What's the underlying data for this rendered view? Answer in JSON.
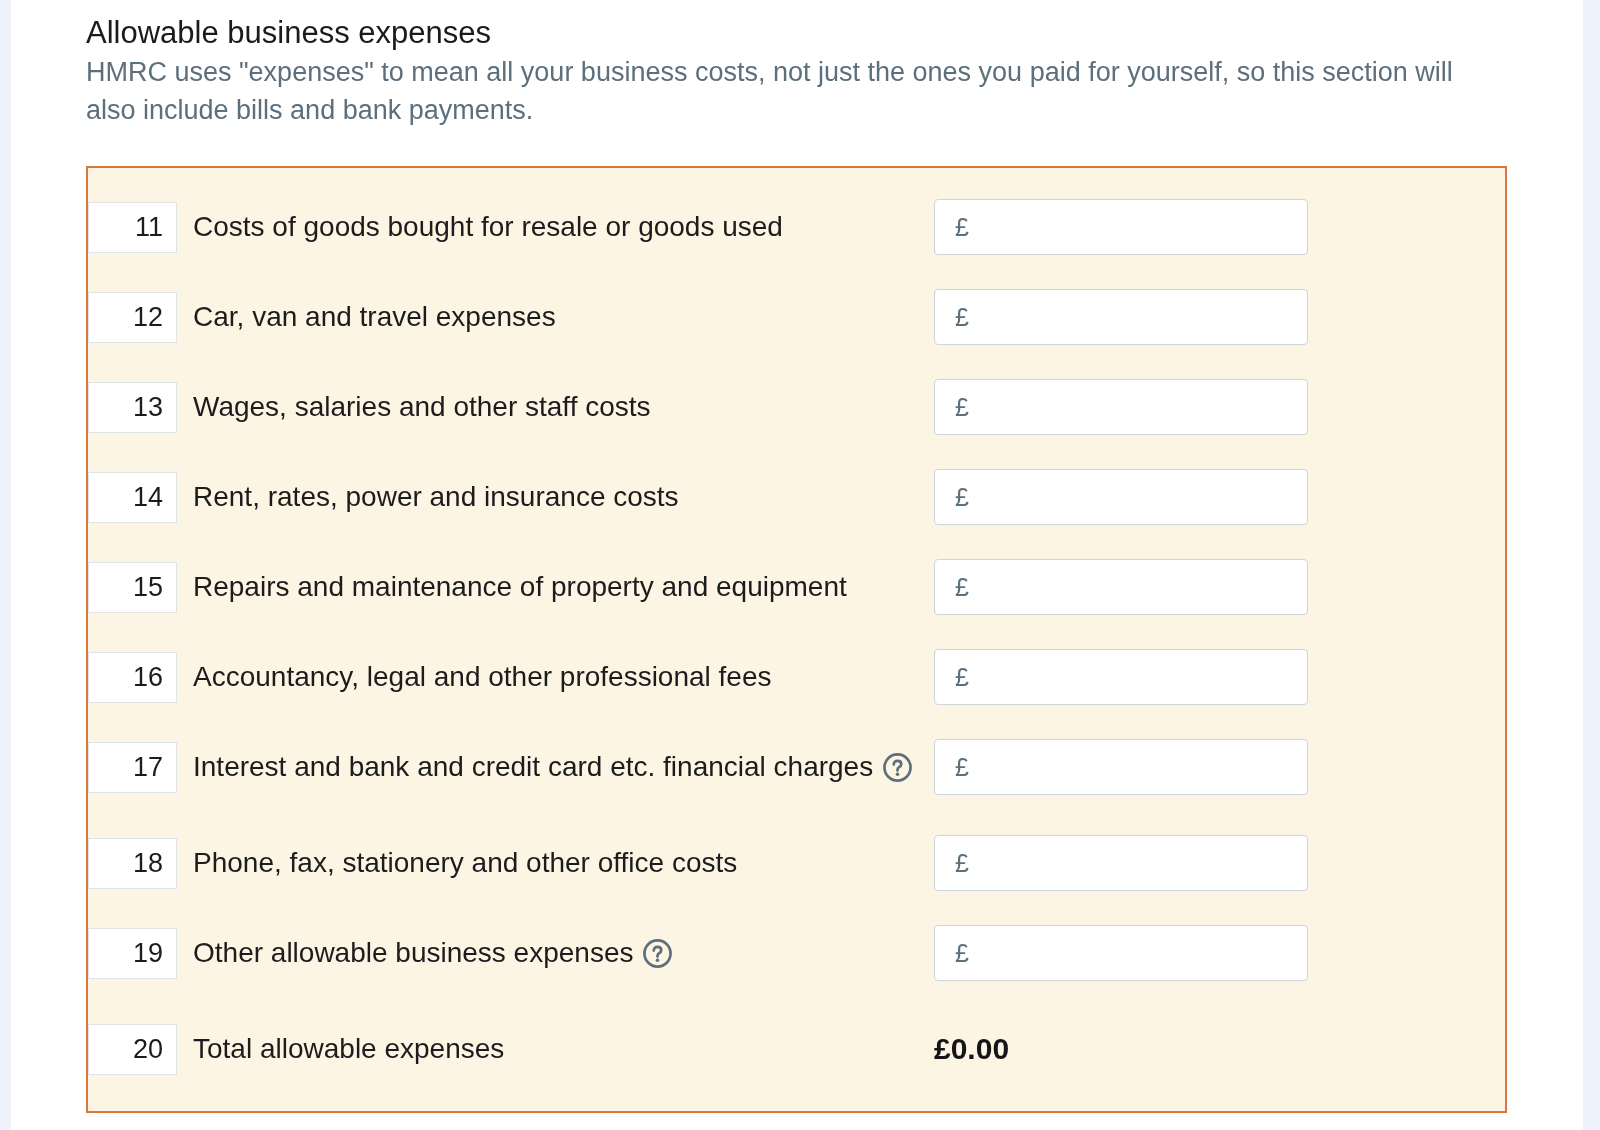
{
  "section": {
    "title": "Allowable business expenses",
    "description": "HMRC uses \"expenses\" to mean all your business costs, not just the ones you paid for yourself, so this section will also include bills and bank payments."
  },
  "expense_lines": [
    {
      "number": "11",
      "label": "Costs of goods bought for resale or goods used",
      "kind": "amount",
      "help": false,
      "placeholder": "£"
    },
    {
      "number": "12",
      "label": "Car, van and travel expenses",
      "kind": "amount",
      "help": false,
      "placeholder": "£"
    },
    {
      "number": "13",
      "label": "Wages, salaries and other staff costs",
      "kind": "amount",
      "help": false,
      "placeholder": "£"
    },
    {
      "number": "14",
      "label": "Rent, rates, power and insurance costs",
      "kind": "amount",
      "help": false,
      "placeholder": "£"
    },
    {
      "number": "15",
      "label": "Repairs and maintenance of property and equipment",
      "kind": "amount",
      "help": false,
      "placeholder": "£"
    },
    {
      "number": "16",
      "label": "Accountancy, legal and other professional fees",
      "kind": "amount",
      "help": false,
      "placeholder": "£"
    },
    {
      "number": "17",
      "label": "Interest and bank and credit card etc. financial charges",
      "kind": "amount",
      "help": true,
      "placeholder": "£"
    },
    {
      "number": "18",
      "label": "Phone, fax, stationery and other office costs",
      "kind": "amount",
      "help": false,
      "placeholder": "£"
    },
    {
      "number": "19",
      "label": "Other allowable business expenses",
      "kind": "amount",
      "help": true,
      "placeholder": "£"
    },
    {
      "number": "20",
      "label": "Total allowable expenses",
      "kind": "total",
      "help": false,
      "value": "£0.00"
    }
  ]
}
